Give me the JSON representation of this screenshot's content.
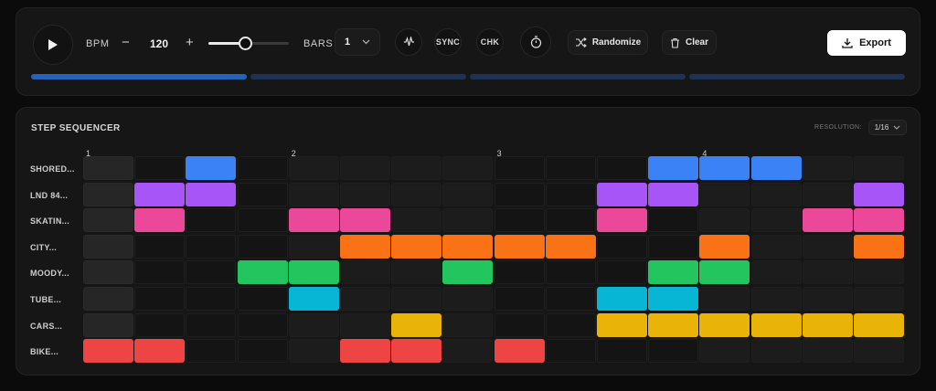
{
  "transport": {
    "bpm_label": "BPM",
    "bpm_minus": "−",
    "bpm_value": "120",
    "bpm_plus": "+",
    "bpm_slider_value": 0.45,
    "bars_label": "BARS",
    "bars_value": "1",
    "sync_label": "SYNC",
    "chk_label": "CHK",
    "randomize_label": "Randomize",
    "clear_label": "Clear",
    "export_label": "Export",
    "play_icon": "play-icon",
    "bar_progress": [
      1,
      0,
      0,
      0
    ]
  },
  "sequencer": {
    "title": "STEP SEQUENCER",
    "resolution_label": "RESOLUTION:",
    "resolution_value": "1/16",
    "bar_numbers": [
      "1",
      "2",
      "3",
      "4"
    ],
    "tracks": [
      {
        "name": "SHORED...",
        "color": "#3b82f6",
        "steps": [
          0,
          0,
          1,
          0,
          0,
          0,
          0,
          0,
          0,
          0,
          0,
          1,
          1,
          1,
          0,
          0
        ]
      },
      {
        "name": "LND 84...",
        "color": "#a855f7",
        "steps": [
          0,
          1,
          1,
          0,
          0,
          0,
          0,
          0,
          0,
          0,
          1,
          1,
          0,
          0,
          0,
          1
        ]
      },
      {
        "name": "SKATIN...",
        "color": "#ec4899",
        "steps": [
          0,
          1,
          0,
          0,
          1,
          1,
          0,
          0,
          0,
          0,
          1,
          0,
          0,
          0,
          1,
          1
        ]
      },
      {
        "name": "CITY...",
        "color": "#f97316",
        "steps": [
          0,
          0,
          0,
          0,
          0,
          1,
          1,
          1,
          1,
          1,
          0,
          0,
          1,
          0,
          0,
          1
        ]
      },
      {
        "name": "MOODY...",
        "color": "#22c55e",
        "steps": [
          0,
          0,
          0,
          1,
          1,
          0,
          0,
          1,
          0,
          0,
          0,
          1,
          1,
          0,
          0,
          0
        ]
      },
      {
        "name": "TUBE...",
        "color": "#06b6d4",
        "steps": [
          0,
          0,
          0,
          0,
          1,
          0,
          0,
          0,
          0,
          0,
          1,
          1,
          0,
          0,
          0,
          0
        ]
      },
      {
        "name": "CARS...",
        "color": "#eab308",
        "steps": [
          0,
          0,
          0,
          0,
          0,
          0,
          1,
          0,
          0,
          0,
          1,
          1,
          1,
          1,
          1,
          1
        ]
      },
      {
        "name": "BIKE...",
        "color": "#ef4444",
        "steps": [
          1,
          1,
          0,
          0,
          0,
          1,
          1,
          0,
          1,
          0,
          0,
          0,
          0,
          0,
          0,
          0
        ]
      }
    ]
  }
}
